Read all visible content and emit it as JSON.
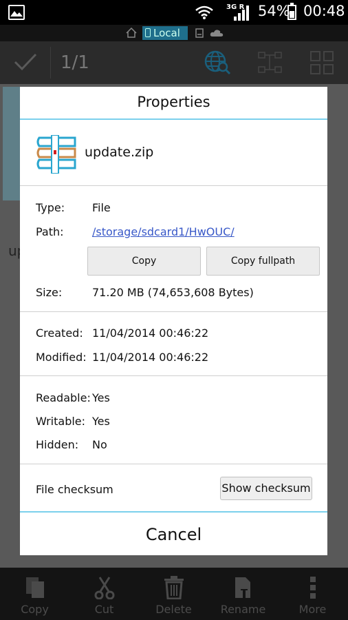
{
  "status_bar": {
    "network_type": "3G",
    "roaming": "R",
    "battery_percent": "54%",
    "battery_level": 0.54,
    "time": "00:48"
  },
  "location_bar": {
    "active_label": "Local",
    "icons": [
      "home-icon",
      "phone-icon",
      "drive-icon",
      "cloud-icon"
    ]
  },
  "toolbar": {
    "selection_count": "1/1",
    "icons": [
      "check-icon",
      "globe-search-icon",
      "tree-select-icon",
      "grid-view-icon"
    ]
  },
  "dialog": {
    "title": "Properties",
    "file_name": "update.zip",
    "details": {
      "type_label": "Type:",
      "type_value": "File",
      "path_label": "Path:",
      "path_value": "/storage/sdcard1/HwOUC/",
      "copy_label": "Copy",
      "copy_full_label": "Copy fullpath",
      "size_label": "Size:",
      "size_value": "71.20 MB (74,653,608 Bytes)"
    },
    "dates": {
      "created_label": "Created:",
      "created_value": "11/04/2014 00:46:22",
      "modified_label": "Modified:",
      "modified_value": "11/04/2014 00:46:22"
    },
    "permissions": {
      "readable_label": "Readable:",
      "readable_value": "Yes",
      "writable_label": "Writable:",
      "writable_value": "Yes",
      "hidden_label": "Hidden:",
      "hidden_value": "No"
    },
    "checksum": {
      "label": "File checksum",
      "button": "Show checksum"
    },
    "cancel": "Cancel"
  },
  "content": {
    "tile_fragment": "up"
  },
  "bottom_bar": [
    {
      "label": "Copy",
      "icon": "copy-icon"
    },
    {
      "label": "Cut",
      "icon": "cut-icon"
    },
    {
      "label": "Delete",
      "icon": "trash-icon"
    },
    {
      "label": "Rename",
      "icon": "rename-icon"
    },
    {
      "label": "More",
      "icon": "more-icon"
    }
  ],
  "colors": {
    "accent": "#7bd0ec",
    "link": "#3858c8",
    "local_chip": "#1f6f8c"
  }
}
